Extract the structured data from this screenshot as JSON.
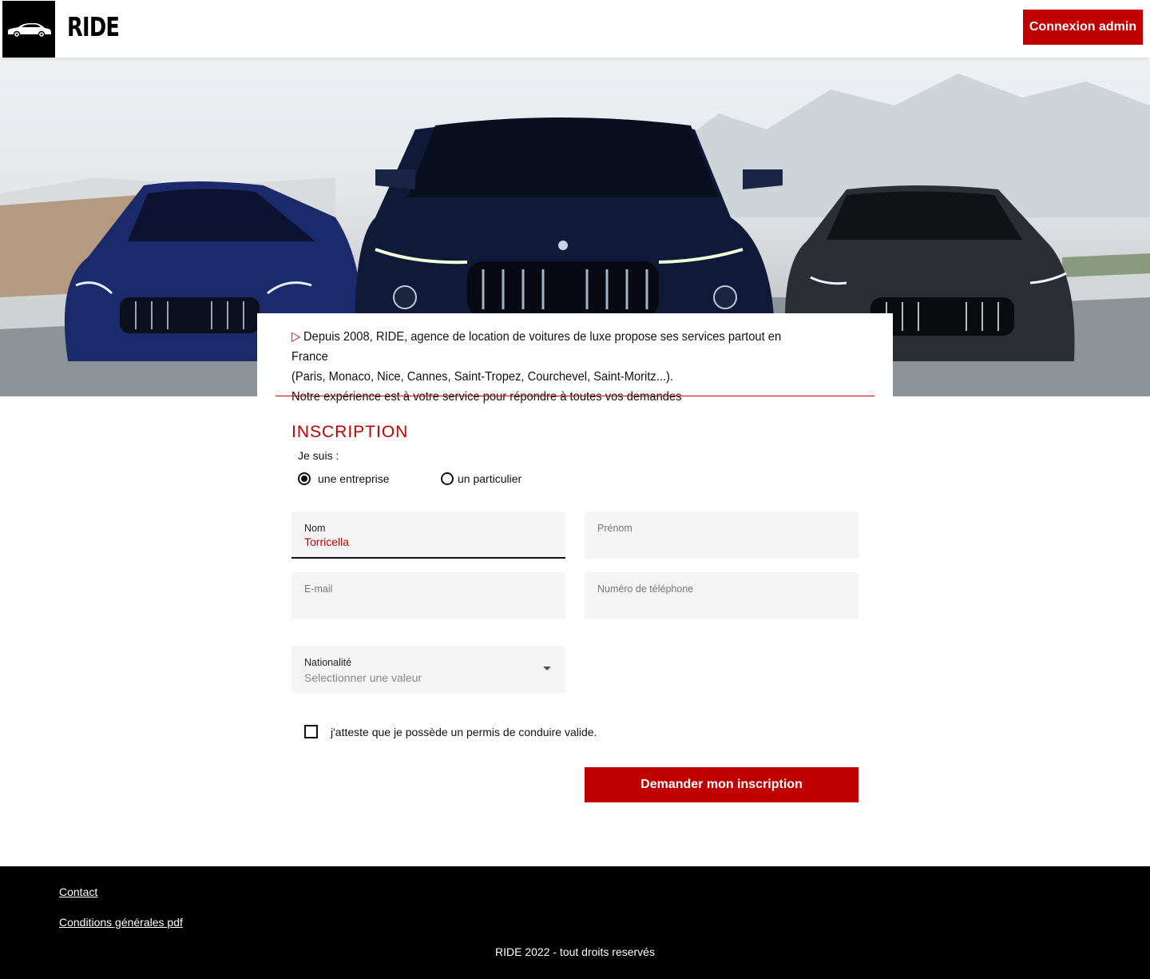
{
  "header": {
    "brand": "RIDE",
    "admin_button": "Connexion admin",
    "logo_icon": "car-icon"
  },
  "hero": {
    "image": "three-luxury-cars-photo"
  },
  "intro": {
    "arrow": "▷",
    "line1": "Depuis 2008, RIDE, agence de location de voitures de luxe propose ses services partout en France",
    "line2": "(Paris, Monaco, Nice, Cannes, Saint-Tropez, Courchevel, Saint-Moritz...).",
    "line3": "Notre expérience est à votre service pour répondre à toutes vos demandes"
  },
  "form": {
    "title": "INSCRIPTION",
    "je_suis": "Je suis  :",
    "radio_options": [
      {
        "label": "une entreprise",
        "selected": true
      },
      {
        "label": "un particulier",
        "selected": false
      }
    ],
    "fields": {
      "nom": {
        "label": "Nom",
        "value": "Torricella"
      },
      "prenom": {
        "label": "Prénom",
        "value": ""
      },
      "email": {
        "label": "E-mail",
        "value": ""
      },
      "telephone": {
        "label": "Numéro de téléphone",
        "value": ""
      },
      "nationalite": {
        "label": "Nationalité",
        "placeholder": "Selectionner une valeur"
      }
    },
    "checkbox_label": "j'atteste que je possède un permis de conduire valide.",
    "submit": "Demander mon inscription"
  },
  "footer": {
    "links": [
      "Contact",
      "Conditions générales pdf"
    ],
    "copyright": "RIDE 2022 - tout droits reservés"
  },
  "colors": {
    "accent": "#c00000",
    "footer_bg": "#000000",
    "field_bg": "#f5f5f5"
  }
}
